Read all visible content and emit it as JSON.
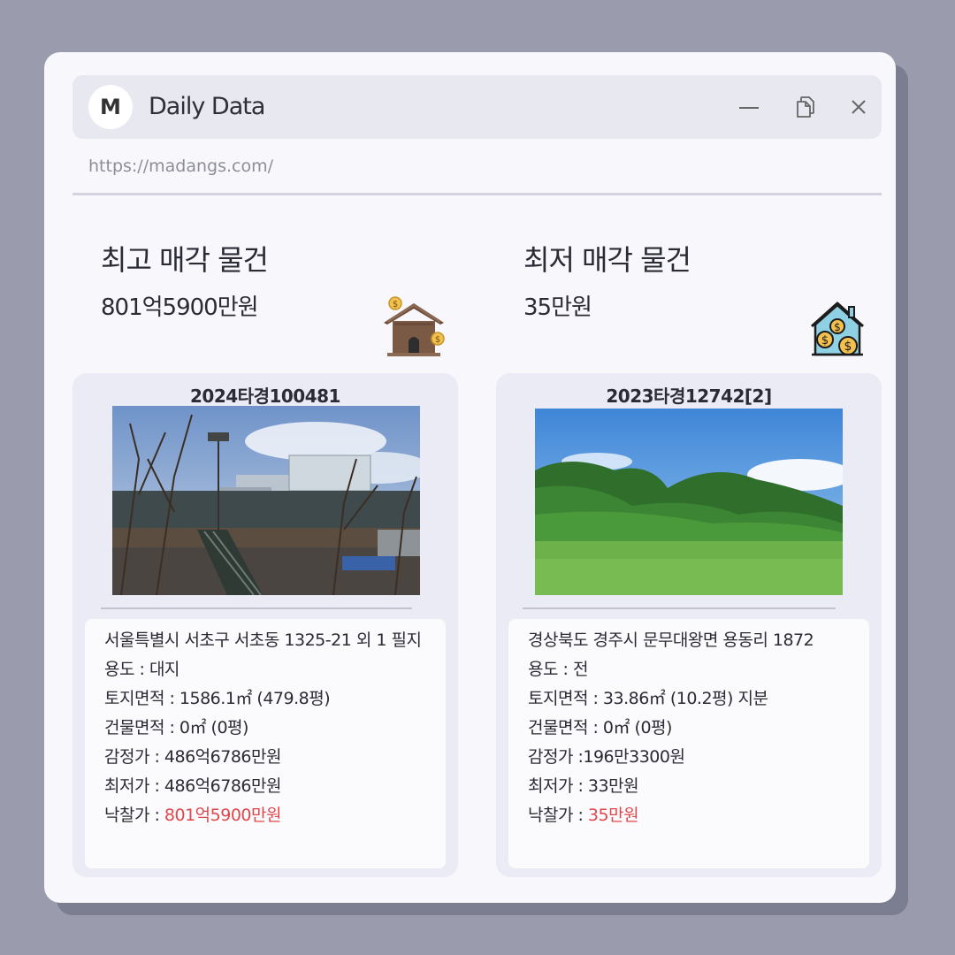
{
  "window": {
    "title": "Daily Data",
    "avatar_letter": "M",
    "url": "https://madangs.com/"
  },
  "highest": {
    "label": "최고 매각 물건",
    "price": "801억5900만원",
    "icon": "house-money-icon",
    "case_no": "2024타경100481",
    "address": "서울특별시 서초구 서초동 1325-21 외 1 필지",
    "use": "용도 : 대지",
    "land_area": "토지면적 : 1586.1㎡ (479.8평)",
    "building_area": "건물면적 : 0㎡ (0평)",
    "appraisal": "감정가 : 486억6786만원",
    "minimum": "최저가 : 486억6786만원",
    "winning_label": "낙찰가 : ",
    "winning_value": "801억5900만원"
  },
  "lowest": {
    "label": "최저 매각 물건",
    "price": "35만원",
    "icon": "house-coins-icon",
    "case_no": "2023타경12742[2]",
    "address": "경상북도 경주시 문무대왕면 용동리 1872",
    "use": "용도 : 전",
    "land_area": "토지면적 : 33.86㎡ (10.2평) 지분",
    "building_area": "건물면적 : 0㎡ (0평)",
    "appraisal": "감정가 :196만3300원",
    "minimum": "최저가 : 33만원",
    "winning_label": "낙찰가 : ",
    "winning_value": "35만원"
  },
  "colors": {
    "background": "#9a9cae",
    "window": "#f7f7fc",
    "accent_red": "#e0474b"
  }
}
